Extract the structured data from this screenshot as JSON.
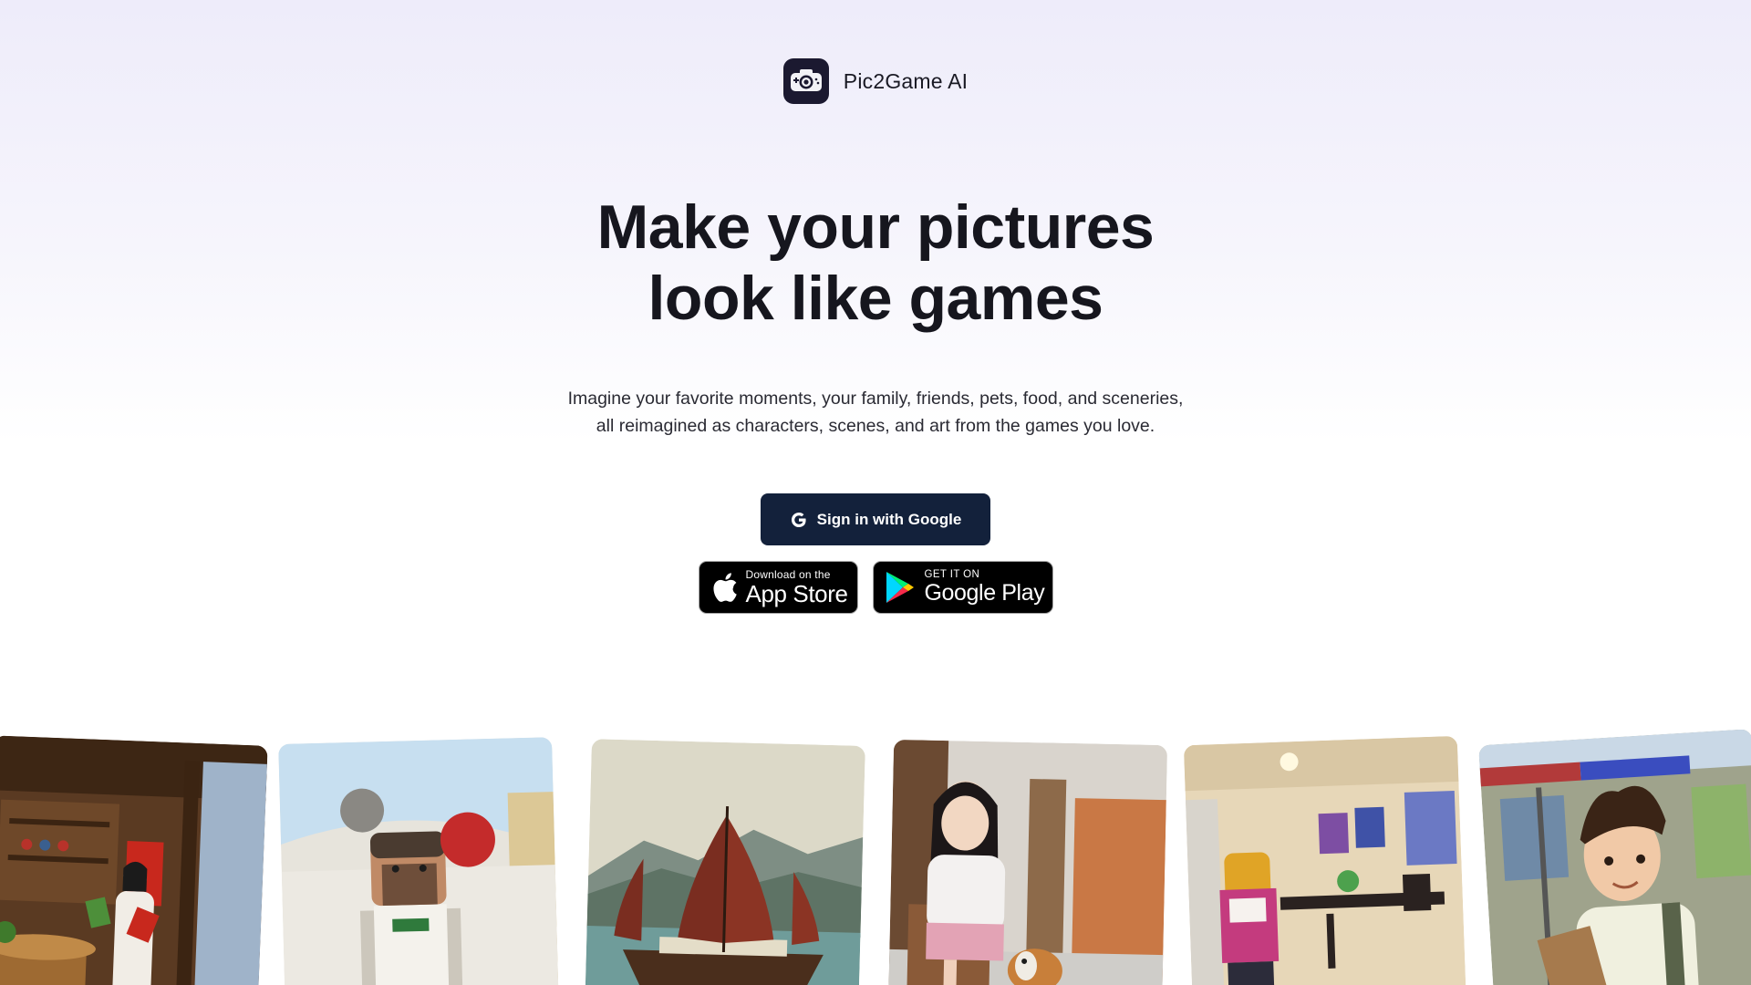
{
  "brand": {
    "name": "Pic2Game AI",
    "logo_icon": "camera-gamepad-icon"
  },
  "hero": {
    "title_line1": "Make your pictures",
    "title_line2": "look like games",
    "subtitle_line1": "Imagine your favorite moments, your family, friends, pets, food, and sceneries,",
    "subtitle_line2": "all reimagined as characters, scenes, and art from the games you love."
  },
  "actions": {
    "google_signin_label": "Sign in with Google",
    "app_store": {
      "small": "Download on the",
      "big": "App Store"
    },
    "google_play": {
      "small": "GET IT ON",
      "big": "Google Play"
    }
  },
  "colors": {
    "primary_button": "#13213b",
    "logo_bg": "#1b1930",
    "text": "#16161e"
  },
  "gallery": [
    {
      "subject": "woman in tea shop interior"
    },
    {
      "subject": "lego figure carrying toys"
    },
    {
      "subject": "junk boat in harbor"
    },
    {
      "subject": "girl petting dog"
    },
    {
      "subject": "lego figure in classroom"
    },
    {
      "subject": "boy with backpack on street"
    }
  ]
}
